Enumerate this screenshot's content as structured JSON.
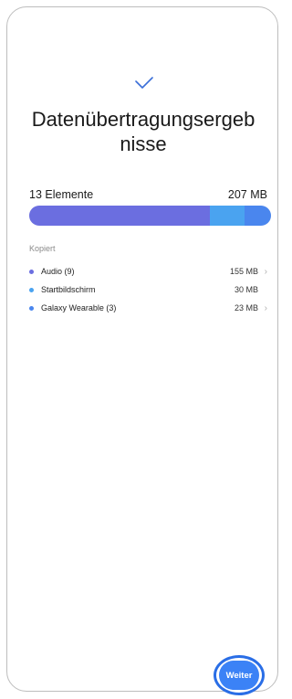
{
  "header": {
    "check_icon": "checkmark-icon",
    "title_line1": "Datenübertragungsergeb",
    "title_line2": "nisse"
  },
  "summary": {
    "count_label": "13 Elemente",
    "total_size": "207 MB"
  },
  "bar": {
    "segments": [
      {
        "name": "Audio (9)",
        "fraction": 0.749,
        "color": "#6b6ee0"
      },
      {
        "name": "Startbildschirm",
        "fraction": 0.145,
        "color": "#4aa3f0"
      },
      {
        "name": "Galaxy Wearable (3)",
        "fraction": 0.111,
        "color": "#4a86ee"
      }
    ]
  },
  "section": {
    "label": "Kopiert"
  },
  "items": [
    {
      "label": "Audio (9)",
      "size": "155 MB",
      "dot_color": "#6b6ee0",
      "chevron": "›"
    },
    {
      "label": "Startbildschirm",
      "size": "30 MB",
      "dot_color": "#4aa3f0",
      "chevron": ""
    },
    {
      "label": "Galaxy Wearable (3)",
      "size": "23 MB",
      "dot_color": "#4a86ee",
      "chevron": "›"
    }
  ],
  "footer": {
    "next_label": "Weiter"
  }
}
